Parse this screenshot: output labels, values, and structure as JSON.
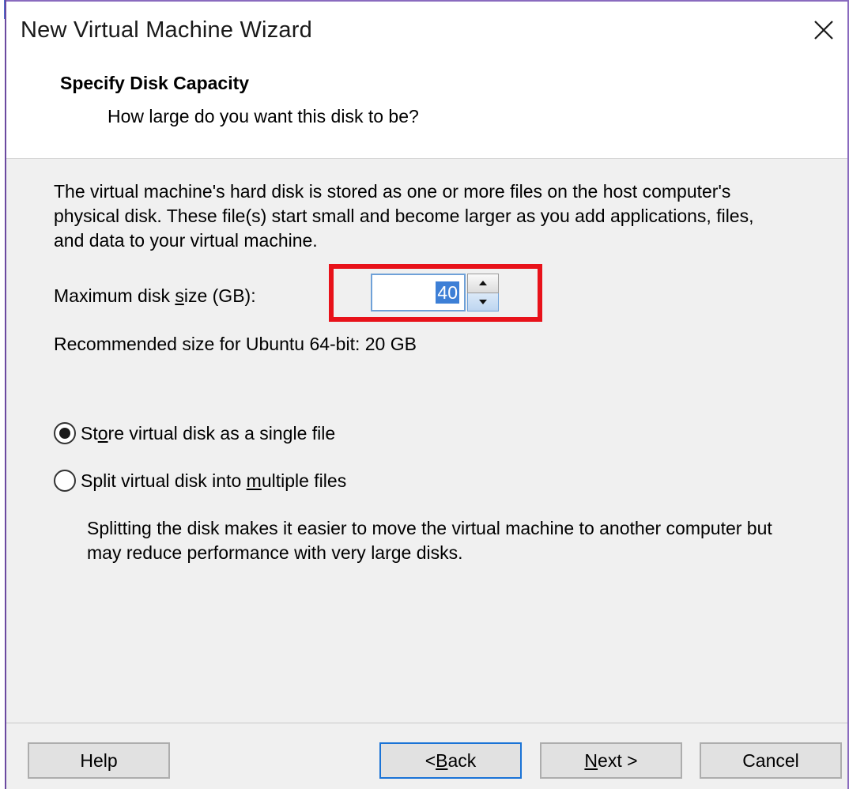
{
  "window": {
    "title": "New Virtual Machine Wizard"
  },
  "header": {
    "heading": "Specify Disk Capacity",
    "subheading": "How large do you want this disk to be?"
  },
  "main": {
    "description": "The virtual machine's hard disk is stored as one or more files on the host computer's physical disk. These file(s) start small and become larger as you add applications, files, and data to your virtual machine.",
    "size_label_pre": "Maximum disk ",
    "size_label_u": "s",
    "size_label_post": "ize (GB):",
    "disk_size_value": "40",
    "recommended": "Recommended size for Ubuntu 64-bit: 20 GB",
    "options": [
      {
        "label_pre": "St",
        "label_u": "o",
        "label_post": "re virtual disk as a single file",
        "selected": true
      },
      {
        "label_pre": "Split virtual disk into ",
        "label_u": "m",
        "label_post": "ultiple files",
        "selected": false
      }
    ],
    "split_note": "Splitting the disk makes it easier to move the virtual machine to another computer but may reduce performance with very large disks."
  },
  "footer": {
    "help_label": "Help",
    "back_pre": "< ",
    "back_u": "B",
    "back_post": "ack",
    "next_u": "N",
    "next_post": "ext >",
    "cancel_label": "Cancel"
  },
  "colors": {
    "highlight": "#e8121a",
    "selection": "#3d7fd6",
    "focus_border": "#1a73d6"
  },
  "icons": [
    "close-icon",
    "spin-up-icon",
    "spin-down-icon"
  ]
}
